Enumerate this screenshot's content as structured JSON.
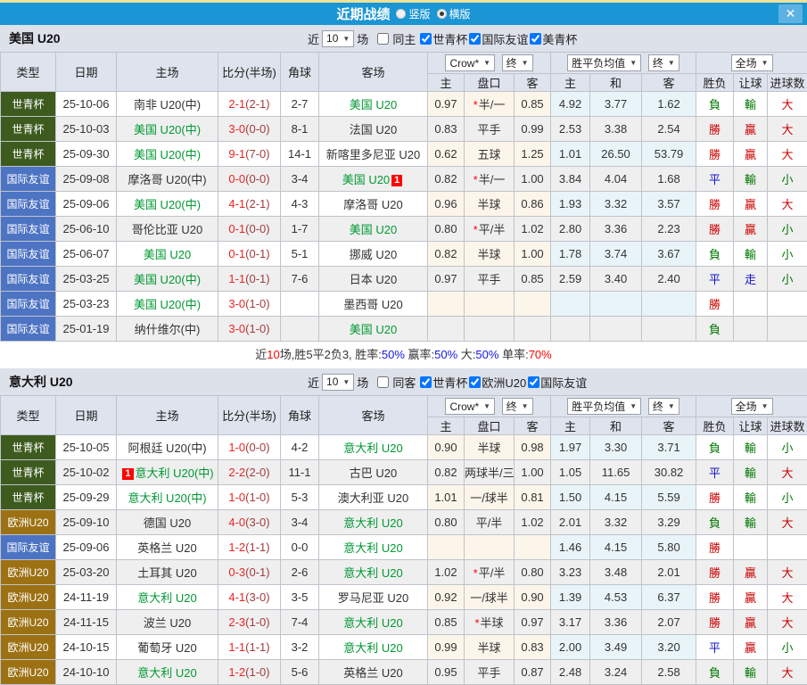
{
  "titlebar": {
    "title": "近期战绩",
    "vertical_label": "竖版",
    "horizontal_label": "横版",
    "close_label": "✕"
  },
  "thead": {
    "cols": [
      "类型",
      "日期",
      "主场",
      "比分(半场)",
      "角球",
      "客场"
    ],
    "sub": [
      "主",
      "盘口",
      "客",
      "主",
      "和",
      "客",
      "胜负",
      "让球",
      "进球数"
    ],
    "crow": "Crow*",
    "final": "终",
    "mean": "胜平负均值",
    "final2": "终",
    "full": "全场"
  },
  "colors": {
    "titlebar_bg": "#1b95d3",
    "team_green": "#009933",
    "type_worldcup": "#3d5b1e",
    "type_friendly": "#4d73c3",
    "type_euro": "#9c7113",
    "win_red": "#cc0000",
    "lose_green": "#007700",
    "draw_blue": "#1414cc",
    "score_red": "#f02222",
    "half_score": "#a33c3c"
  },
  "sections": [
    {
      "team": "美国 U20",
      "near_label": "近",
      "count": "10",
      "games_label": "场",
      "same_label": "同主",
      "filters": [
        "世青杯",
        "国际友谊",
        "美青杯"
      ],
      "rows": [
        {
          "type": "世青杯",
          "tc": "wc",
          "date": "25-10-06",
          "home": {
            "t": "南非 U20(中)",
            "g": false
          },
          "score": "2-1",
          "half": "(2-1)",
          "corner": "2-7",
          "away": {
            "t": "美国 U20",
            "g": true
          },
          "o1": "0.97",
          "hc": "半/一",
          "star": true,
          "o2": "0.85",
          "m1": "4.92",
          "m2": "3.77",
          "m3": "1.62",
          "r1": {
            "t": "負",
            "c": "g"
          },
          "r2": {
            "t": "輸",
            "c": "g"
          },
          "r3": {
            "t": "大",
            "c": "r"
          }
        },
        {
          "type": "世青杯",
          "tc": "wc",
          "date": "25-10-03",
          "home": {
            "t": "美国 U20(中)",
            "g": true
          },
          "score": "3-0",
          "half": "(0-0)",
          "corner": "8-1",
          "away": {
            "t": "法国 U20",
            "g": false
          },
          "o1": "0.83",
          "hc": "平手",
          "star": false,
          "o2": "0.99",
          "m1": "2.53",
          "m2": "3.38",
          "m3": "2.54",
          "r1": {
            "t": "勝",
            "c": "r"
          },
          "r2": {
            "t": "贏",
            "c": "r"
          },
          "r3": {
            "t": "大",
            "c": "r"
          }
        },
        {
          "type": "世青杯",
          "tc": "wc",
          "date": "25-09-30",
          "home": {
            "t": "美国 U20(中)",
            "g": true
          },
          "score": "9-1",
          "half": "(7-0)",
          "corner": "14-1",
          "away": {
            "t": "新喀里多尼亚 U20",
            "g": false
          },
          "o1": "0.62",
          "hc": "五球",
          "star": false,
          "o2": "1.25",
          "m1": "1.01",
          "m2": "26.50",
          "m3": "53.79",
          "r1": {
            "t": "勝",
            "c": "r"
          },
          "r2": {
            "t": "贏",
            "c": "r"
          },
          "r3": {
            "t": "大",
            "c": "r"
          }
        },
        {
          "type": "国际友谊",
          "tc": "fr",
          "date": "25-09-08",
          "home": {
            "t": "摩洛哥 U20(中)",
            "g": false
          },
          "score": "0-0",
          "half": "(0-0)",
          "corner": "3-4",
          "away": {
            "t": "美国 U20",
            "g": true,
            "badge": "1",
            "pos": "after"
          },
          "o1": "0.82",
          "hc": "半/一",
          "star": true,
          "o2": "1.00",
          "m1": "3.84",
          "m2": "4.04",
          "m3": "1.68",
          "r1": {
            "t": "平",
            "c": "b"
          },
          "r2": {
            "t": "輸",
            "c": "g"
          },
          "r3": {
            "t": "小",
            "c": "g"
          }
        },
        {
          "type": "国际友谊",
          "tc": "fr",
          "date": "25-09-06",
          "home": {
            "t": "美国 U20(中)",
            "g": true
          },
          "score": "4-1",
          "half": "(2-1)",
          "corner": "4-3",
          "away": {
            "t": "摩洛哥 U20",
            "g": false
          },
          "o1": "0.96",
          "hc": "半球",
          "star": false,
          "o2": "0.86",
          "m1": "1.93",
          "m2": "3.32",
          "m3": "3.57",
          "r1": {
            "t": "勝",
            "c": "r"
          },
          "r2": {
            "t": "贏",
            "c": "r"
          },
          "r3": {
            "t": "大",
            "c": "r"
          }
        },
        {
          "type": "国际友谊",
          "tc": "fr",
          "date": "25-06-10",
          "home": {
            "t": "哥伦比亚 U20",
            "g": false
          },
          "score": "0-1",
          "half": "(0-0)",
          "corner": "1-7",
          "away": {
            "t": "美国 U20",
            "g": true
          },
          "o1": "0.80",
          "hc": "平/半",
          "star": true,
          "o2": "1.02",
          "m1": "2.80",
          "m2": "3.36",
          "m3": "2.23",
          "r1": {
            "t": "勝",
            "c": "r"
          },
          "r2": {
            "t": "贏",
            "c": "r"
          },
          "r3": {
            "t": "小",
            "c": "g"
          }
        },
        {
          "type": "国际友谊",
          "tc": "fr",
          "date": "25-06-07",
          "home": {
            "t": "美国 U20",
            "g": true
          },
          "score": "0-1",
          "half": "(0-1)",
          "corner": "5-1",
          "away": {
            "t": "挪威 U20",
            "g": false
          },
          "o1": "0.82",
          "hc": "半球",
          "star": false,
          "o2": "1.00",
          "m1": "1.78",
          "m2": "3.74",
          "m3": "3.67",
          "r1": {
            "t": "負",
            "c": "g"
          },
          "r2": {
            "t": "輸",
            "c": "g"
          },
          "r3": {
            "t": "小",
            "c": "g"
          }
        },
        {
          "type": "国际友谊",
          "tc": "fr",
          "date": "25-03-25",
          "home": {
            "t": "美国 U20(中)",
            "g": true
          },
          "score": "1-1",
          "half": "(0-1)",
          "corner": "7-6",
          "away": {
            "t": "日本 U20",
            "g": false
          },
          "o1": "0.97",
          "hc": "平手",
          "star": false,
          "o2": "0.85",
          "m1": "2.59",
          "m2": "3.40",
          "m3": "2.40",
          "r1": {
            "t": "平",
            "c": "b"
          },
          "r2": {
            "t": "走",
            "c": "b"
          },
          "r3": {
            "t": "小",
            "c": "g"
          }
        },
        {
          "type": "国际友谊",
          "tc": "fr",
          "date": "25-03-23",
          "home": {
            "t": "美国 U20(中)",
            "g": true
          },
          "score": "3-0",
          "half": "(1-0)",
          "corner": "",
          "away": {
            "t": "墨西哥 U20",
            "g": false
          },
          "o1": "",
          "hc": "",
          "star": false,
          "o2": "",
          "m1": "",
          "m2": "",
          "m3": "",
          "r1": {
            "t": "勝",
            "c": "r"
          },
          "r2": {
            "t": "",
            "c": ""
          },
          "r3": {
            "t": "",
            "c": ""
          }
        },
        {
          "type": "国际友谊",
          "tc": "fr",
          "date": "25-01-19",
          "home": {
            "t": "纳什维尔(中)",
            "g": false
          },
          "score": "3-0",
          "half": "(1-0)",
          "corner": "",
          "away": {
            "t": "美国 U20",
            "g": true
          },
          "o1": "",
          "hc": "",
          "star": false,
          "o2": "",
          "m1": "",
          "m2": "",
          "m3": "",
          "r1": {
            "t": "負",
            "c": "g"
          },
          "r2": {
            "t": "",
            "c": ""
          },
          "r3": {
            "t": "",
            "c": ""
          }
        }
      ],
      "summary": [
        {
          "t": "近",
          "c": "k"
        },
        {
          "t": "10",
          "c": "r"
        },
        {
          "t": "场,胜5平2负3, 胜率:",
          "c": "k"
        },
        {
          "t": "50%",
          "c": "b"
        },
        {
          "t": " 赢率:",
          "c": "k"
        },
        {
          "t": "50%",
          "c": "b"
        },
        {
          "t": " 大:",
          "c": "k"
        },
        {
          "t": "50%",
          "c": "b"
        },
        {
          "t": " 单率:",
          "c": "k"
        },
        {
          "t": "70%",
          "c": "r"
        }
      ]
    },
    {
      "team": "意大利 U20",
      "near_label": "近",
      "count": "10",
      "games_label": "场",
      "same_label": "同客",
      "filters": [
        "世青杯",
        "欧洲U20",
        "国际友谊"
      ],
      "rows": [
        {
          "type": "世青杯",
          "tc": "wc",
          "date": "25-10-05",
          "home": {
            "t": "阿根廷 U20(中)",
            "g": false
          },
          "score": "1-0",
          "half": "(0-0)",
          "corner": "4-2",
          "away": {
            "t": "意大利 U20",
            "g": true
          },
          "o1": "0.90",
          "hc": "半球",
          "star": false,
          "o2": "0.98",
          "m1": "1.97",
          "m2": "3.30",
          "m3": "3.71",
          "r1": {
            "t": "負",
            "c": "g"
          },
          "r2": {
            "t": "輸",
            "c": "g"
          },
          "r3": {
            "t": "小",
            "c": "g"
          }
        },
        {
          "type": "世青杯",
          "tc": "wc",
          "date": "25-10-02",
          "home": {
            "t": "意大利 U20(中)",
            "g": true,
            "badge": "1",
            "pos": "before"
          },
          "score": "2-2",
          "half": "(2-0)",
          "corner": "11-1",
          "away": {
            "t": "古巴 U20",
            "g": false
          },
          "o1": "0.82",
          "hc": "两球半/三",
          "star": false,
          "o2": "1.00",
          "m1": "1.05",
          "m2": "11.65",
          "m3": "30.82",
          "r1": {
            "t": "平",
            "c": "b"
          },
          "r2": {
            "t": "輸",
            "c": "g"
          },
          "r3": {
            "t": "大",
            "c": "r"
          }
        },
        {
          "type": "世青杯",
          "tc": "wc",
          "date": "25-09-29",
          "home": {
            "t": "意大利 U20(中)",
            "g": true
          },
          "score": "1-0",
          "half": "(1-0)",
          "corner": "5-3",
          "away": {
            "t": "澳大利亚 U20",
            "g": false
          },
          "o1": "1.01",
          "hc": "一/球半",
          "star": false,
          "o2": "0.81",
          "m1": "1.50",
          "m2": "4.15",
          "m3": "5.59",
          "r1": {
            "t": "勝",
            "c": "r"
          },
          "r2": {
            "t": "輸",
            "c": "g"
          },
          "r3": {
            "t": "小",
            "c": "g"
          }
        },
        {
          "type": "欧洲U20",
          "tc": "eu",
          "date": "25-09-10",
          "home": {
            "t": "德国 U20",
            "g": false
          },
          "score": "4-0",
          "half": "(3-0)",
          "corner": "3-4",
          "away": {
            "t": "意大利 U20",
            "g": true
          },
          "o1": "0.80",
          "hc": "平/半",
          "star": false,
          "o2": "1.02",
          "m1": "2.01",
          "m2": "3.32",
          "m3": "3.29",
          "r1": {
            "t": "負",
            "c": "g"
          },
          "r2": {
            "t": "輸",
            "c": "g"
          },
          "r3": {
            "t": "大",
            "c": "r"
          }
        },
        {
          "type": "国际友谊",
          "tc": "fr",
          "date": "25-09-06",
          "home": {
            "t": "英格兰 U20",
            "g": false
          },
          "score": "1-2",
          "half": "(1-1)",
          "corner": "0-0",
          "away": {
            "t": "意大利 U20",
            "g": true
          },
          "o1": "",
          "hc": "",
          "star": false,
          "o2": "",
          "m1": "1.46",
          "m2": "4.15",
          "m3": "5.80",
          "r1": {
            "t": "勝",
            "c": "r"
          },
          "r2": {
            "t": "",
            "c": ""
          },
          "r3": {
            "t": "",
            "c": ""
          }
        },
        {
          "type": "欧洲U20",
          "tc": "eu",
          "date": "25-03-20",
          "home": {
            "t": "土耳其 U20",
            "g": false
          },
          "score": "0-3",
          "half": "(0-1)",
          "corner": "2-6",
          "away": {
            "t": "意大利 U20",
            "g": true
          },
          "o1": "1.02",
          "hc": "平/半",
          "star": true,
          "o2": "0.80",
          "m1": "3.23",
          "m2": "3.48",
          "m3": "2.01",
          "r1": {
            "t": "勝",
            "c": "r"
          },
          "r2": {
            "t": "贏",
            "c": "r"
          },
          "r3": {
            "t": "大",
            "c": "r"
          }
        },
        {
          "type": "欧洲U20",
          "tc": "eu",
          "date": "24-11-19",
          "home": {
            "t": "意大利 U20",
            "g": true
          },
          "score": "4-1",
          "half": "(3-0)",
          "corner": "3-5",
          "away": {
            "t": "罗马尼亚 U20",
            "g": false
          },
          "o1": "0.92",
          "hc": "一/球半",
          "star": false,
          "o2": "0.90",
          "m1": "1.39",
          "m2": "4.53",
          "m3": "6.37",
          "r1": {
            "t": "勝",
            "c": "r"
          },
          "r2": {
            "t": "贏",
            "c": "r"
          },
          "r3": {
            "t": "大",
            "c": "r"
          }
        },
        {
          "type": "欧洲U20",
          "tc": "eu",
          "date": "24-11-15",
          "home": {
            "t": "波兰 U20",
            "g": false
          },
          "score": "2-3",
          "half": "(1-0)",
          "corner": "7-4",
          "away": {
            "t": "意大利 U20",
            "g": true
          },
          "o1": "0.85",
          "hc": "半球",
          "star": true,
          "o2": "0.97",
          "m1": "3.17",
          "m2": "3.36",
          "m3": "2.07",
          "r1": {
            "t": "勝",
            "c": "r"
          },
          "r2": {
            "t": "贏",
            "c": "r"
          },
          "r3": {
            "t": "大",
            "c": "r"
          }
        },
        {
          "type": "欧洲U20",
          "tc": "eu",
          "date": "24-10-15",
          "home": {
            "t": "葡萄牙 U20",
            "g": false
          },
          "score": "1-1",
          "half": "(1-1)",
          "corner": "3-2",
          "away": {
            "t": "意大利 U20",
            "g": true
          },
          "o1": "0.99",
          "hc": "半球",
          "star": false,
          "o2": "0.83",
          "m1": "2.00",
          "m2": "3.49",
          "m3": "3.20",
          "r1": {
            "t": "平",
            "c": "b"
          },
          "r2": {
            "t": "贏",
            "c": "r"
          },
          "r3": {
            "t": "小",
            "c": "g"
          }
        },
        {
          "type": "欧洲U20",
          "tc": "eu",
          "date": "24-10-10",
          "home": {
            "t": "意大利 U20",
            "g": true
          },
          "score": "1-2",
          "half": "(1-0)",
          "corner": "5-6",
          "away": {
            "t": "英格兰 U20",
            "g": false
          },
          "o1": "0.95",
          "hc": "平手",
          "star": false,
          "o2": "0.87",
          "m1": "2.48",
          "m2": "3.24",
          "m3": "2.58",
          "r1": {
            "t": "負",
            "c": "g"
          },
          "r2": {
            "t": "輸",
            "c": "g"
          },
          "r3": {
            "t": "大",
            "c": "r"
          }
        }
      ],
      "summary": []
    }
  ]
}
